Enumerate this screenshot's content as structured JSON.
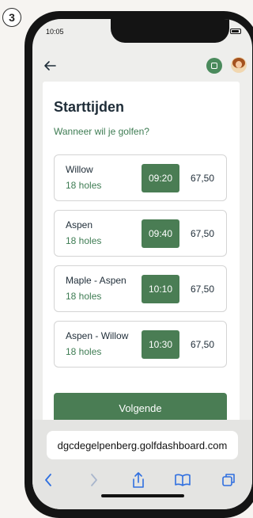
{
  "step_number": "3",
  "status": {
    "time": "10:05"
  },
  "header": {
    "back_icon": "arrow-left-icon",
    "scan_icon": "scan-icon",
    "avatar": "avatar"
  },
  "page": {
    "title": "Starttijden",
    "subtitle": "Wanneer wil je golfen?"
  },
  "slots": [
    {
      "course": "Willow",
      "holes": "18 holes",
      "time": "09:20",
      "price": "67,50"
    },
    {
      "course": "Aspen",
      "holes": "18 holes",
      "time": "09:40",
      "price": "67,50"
    },
    {
      "course": "Maple - Aspen",
      "holes": "18 holes",
      "time": "10:10",
      "price": "67,50"
    },
    {
      "course": "Aspen - Willow",
      "holes": "18 holes",
      "time": "10:30",
      "price": "67,50"
    }
  ],
  "next_button": "Volgende",
  "browser": {
    "url": "dgcdegelpenberg.golfdashboard.com"
  },
  "colors": {
    "accent": "#4a7d54",
    "subtitle": "#3e7c53",
    "title": "#1f2d38"
  }
}
